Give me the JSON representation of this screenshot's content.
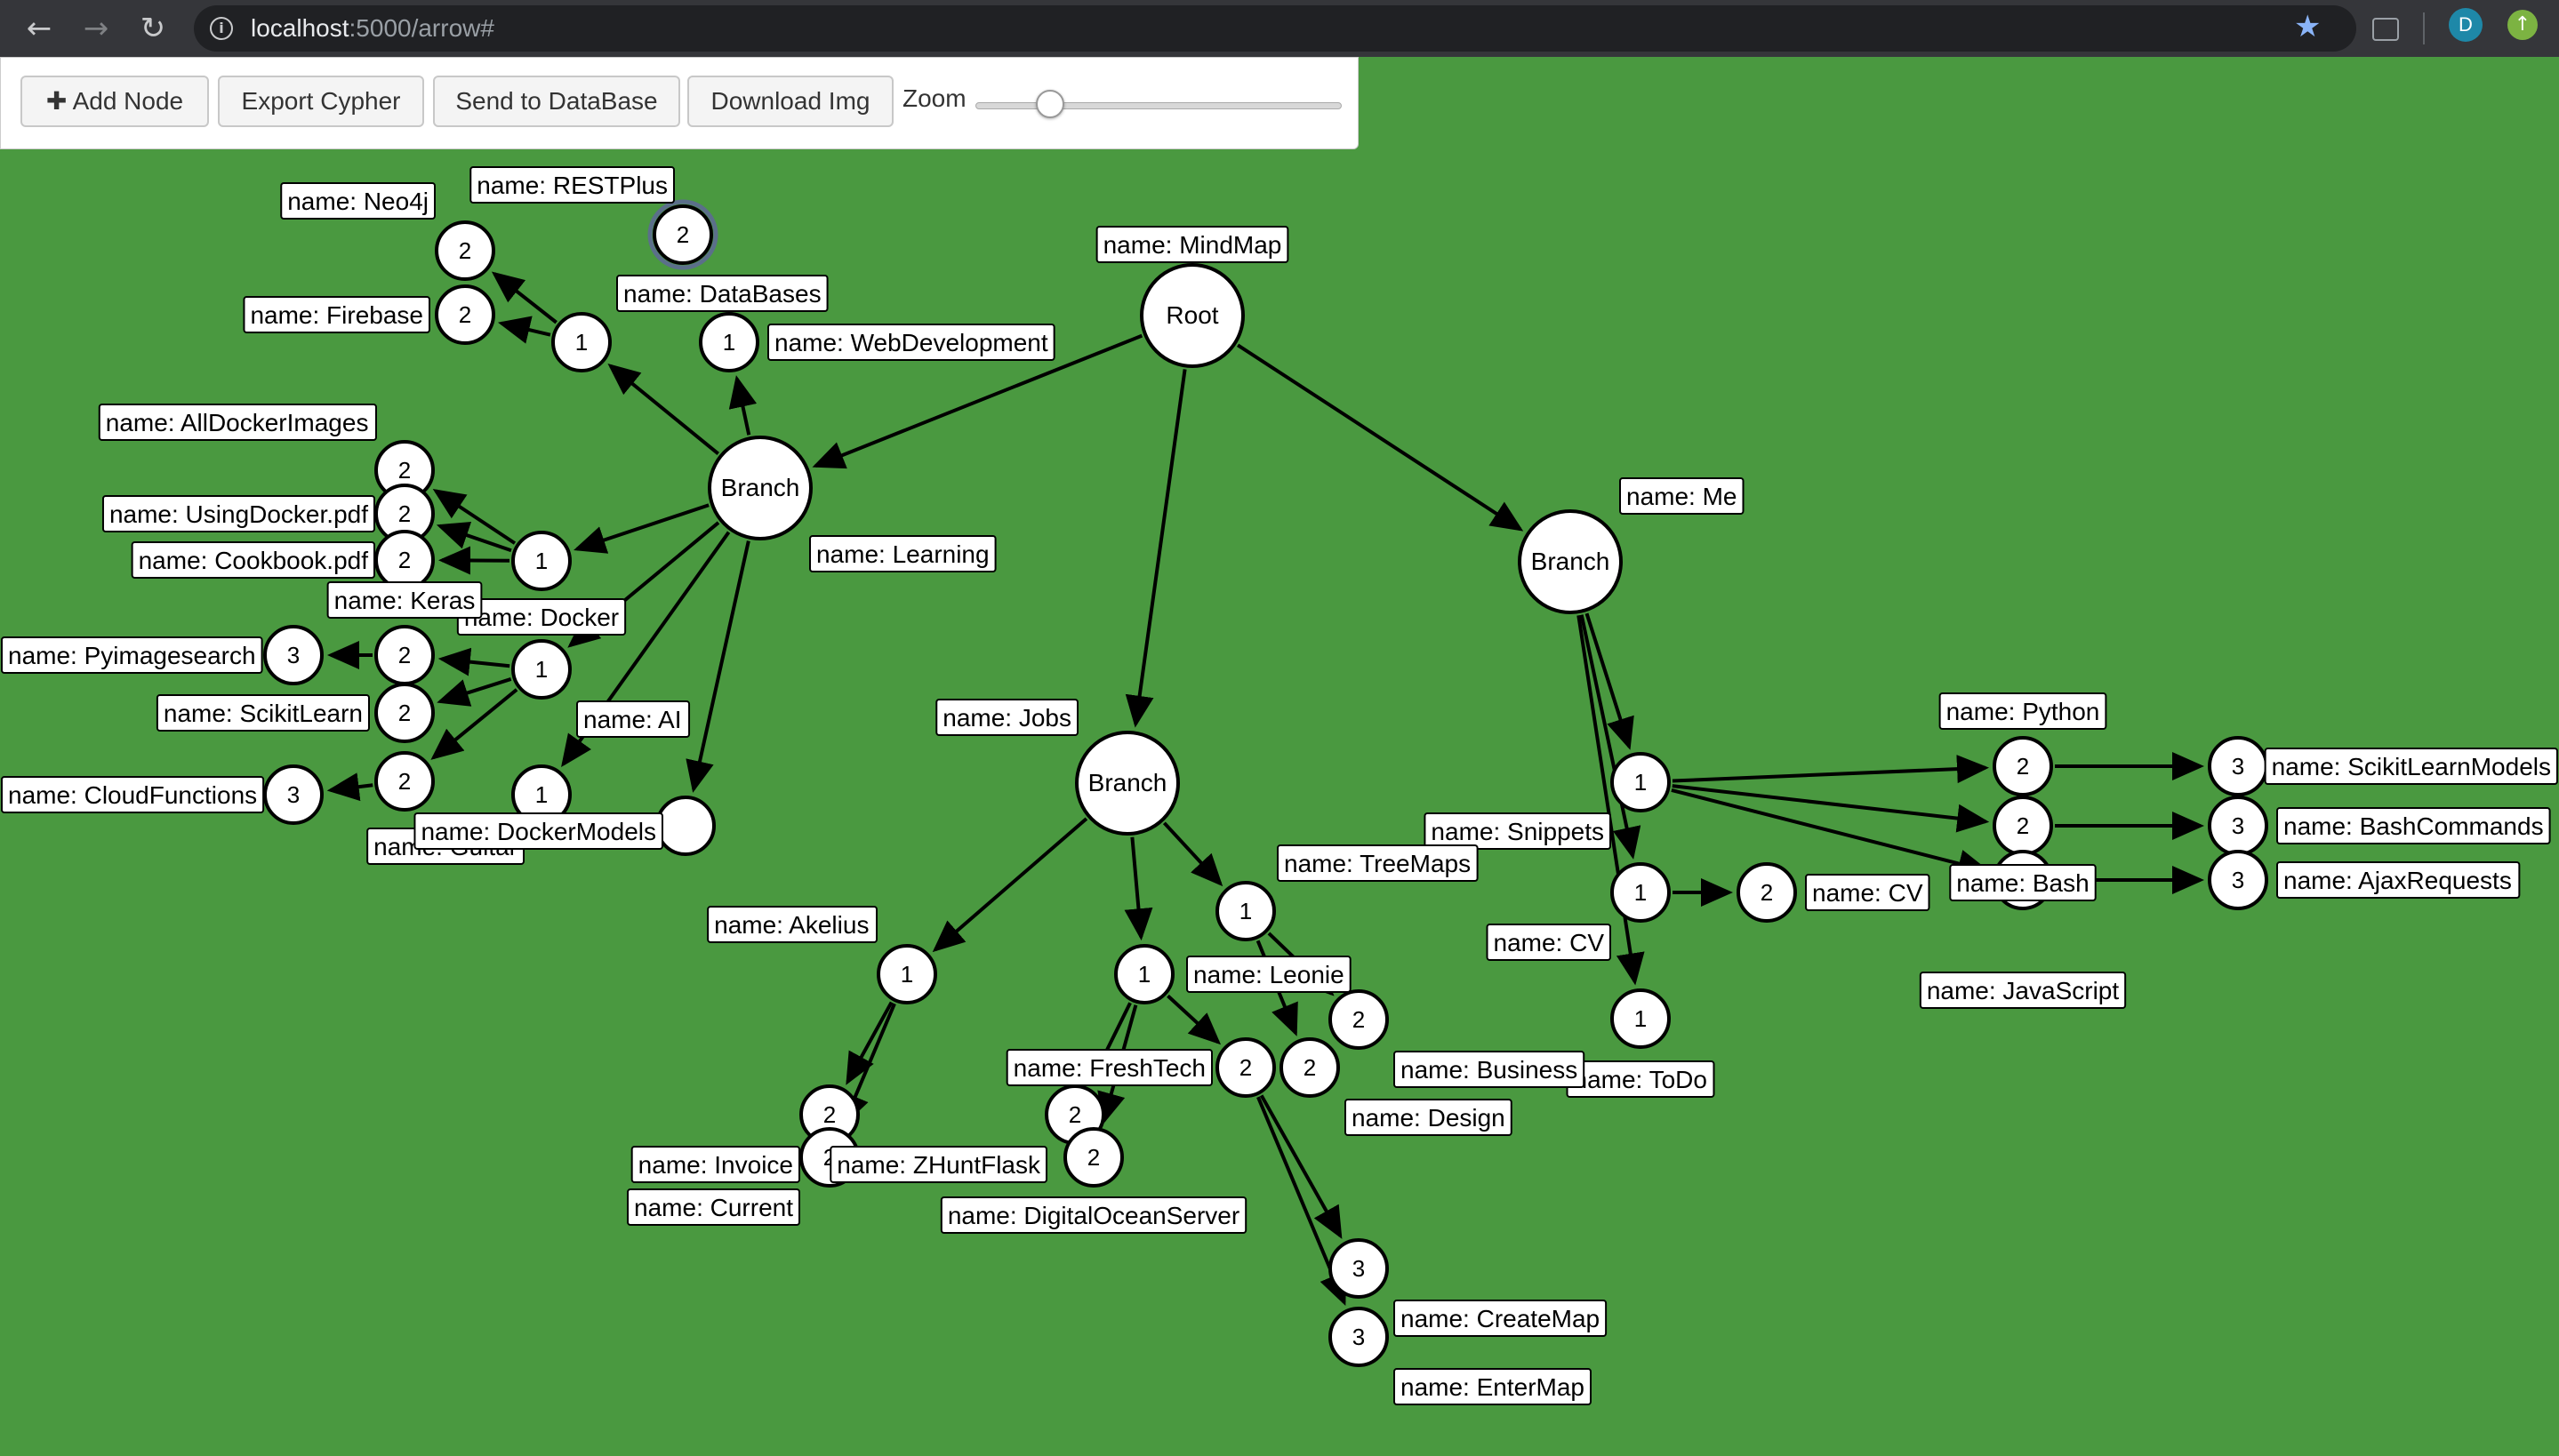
{
  "browser": {
    "url_host": "localhost",
    "url_rest": ":5000/arrow#",
    "avatar_letter": "D",
    "back_icon": "back-arrow-icon",
    "forward_icon": "forward-arrow-icon",
    "reload_icon": "reload-icon",
    "info_icon": "info-icon",
    "star_icon": "bookmark-star-icon",
    "bookmark_star_color": "#8ab4f8"
  },
  "toolbar": {
    "add_node": "Add Node",
    "export_cypher": "Export Cypher",
    "send_db": "Send to DataBase",
    "download_img": "Download Img",
    "zoom_label": "Zoom",
    "zoom_value": 0.2
  },
  "colors": {
    "background": "#4a9940",
    "node_fill": "#ffffff",
    "node_stroke": "#000000",
    "edge": "#000000",
    "selected_ring": "#5b6f8a"
  },
  "graph": {
    "nodes": [
      {
        "id": "root",
        "caption": "Root",
        "label": "name: MindMap",
        "size": "large"
      },
      {
        "id": "learning",
        "caption": "Branch",
        "label": "name: Learning",
        "size": "large"
      },
      {
        "id": "me",
        "caption": "Branch",
        "label": "name: Me",
        "size": "large"
      },
      {
        "id": "jobs",
        "caption": "Branch",
        "label": "name: Jobs",
        "size": "large"
      },
      {
        "id": "databases",
        "caption": "1",
        "label": "name: DataBases"
      },
      {
        "id": "webdev",
        "caption": "1",
        "label": "name: WebDevelopment"
      },
      {
        "id": "restplus",
        "caption": "2",
        "label": "name: RESTPlus",
        "selected": true
      },
      {
        "id": "neo4j",
        "caption": "2",
        "label": "name: Neo4j"
      },
      {
        "id": "firebase",
        "caption": "2",
        "label": "name: Firebase"
      },
      {
        "id": "docker",
        "caption": "1",
        "label": "name: Docker"
      },
      {
        "id": "alldocker",
        "caption": "2",
        "label": "name: AllDockerImages"
      },
      {
        "id": "usingdocker",
        "caption": "2",
        "label": "name: UsingDocker.pdf"
      },
      {
        "id": "cookbook",
        "caption": "2",
        "label": "name: Cookbook.pdf"
      },
      {
        "id": "ai",
        "caption": "1",
        "label": "name: AI"
      },
      {
        "id": "keras",
        "caption": "2",
        "label": "name: Keras"
      },
      {
        "id": "pyimage",
        "caption": "3",
        "label": "name: Pyimagesearch"
      },
      {
        "id": "scikitlearn",
        "caption": "2",
        "label": "name: ScikitLearn"
      },
      {
        "id": "cloud2",
        "caption": "2",
        "label": ""
      },
      {
        "id": "cloudfn",
        "caption": "3",
        "label": "name: CloudFunctions"
      },
      {
        "id": "hidden1",
        "caption": "1",
        "label": "name: Guitar"
      },
      {
        "id": "dockermodels",
        "caption": "",
        "label": "name: DockerModels"
      },
      {
        "id": "snippets",
        "caption": "1",
        "label": "name: Snippets"
      },
      {
        "id": "python",
        "caption": "2",
        "label": "name: Python"
      },
      {
        "id": "bash",
        "caption": "2",
        "label": "name: Bash"
      },
      {
        "id": "javascript",
        "caption": "2",
        "label": "name: JavaScript"
      },
      {
        "id": "scikitmodels",
        "caption": "3",
        "label": "name: ScikitLearnModels"
      },
      {
        "id": "bashcmds",
        "caption": "3",
        "label": "name: BashCommands"
      },
      {
        "id": "ajax",
        "caption": "3",
        "label": "name: AjaxRequests"
      },
      {
        "id": "cv1",
        "caption": "1",
        "label": "name: CV"
      },
      {
        "id": "cv2",
        "caption": "2",
        "label": "name: CV"
      },
      {
        "id": "todo",
        "caption": "1",
        "label": "name: ToDo"
      },
      {
        "id": "akelius",
        "caption": "1",
        "label": "name: Akelius"
      },
      {
        "id": "invoice",
        "caption": "2",
        "label": "name: Invoice"
      },
      {
        "id": "current",
        "caption": "2",
        "label": "name: Current"
      },
      {
        "id": "leonie",
        "caption": "1",
        "label": "name: Leonie"
      },
      {
        "id": "freshtech",
        "caption": "2",
        "label": "name: FreshTech"
      },
      {
        "id": "zhunt",
        "caption": "2",
        "label": "name: ZHuntFlask"
      },
      {
        "id": "digitalocean",
        "caption": "2",
        "label": "name: DigitalOceanServer"
      },
      {
        "id": "treemaps",
        "caption": "1",
        "label": "name: TreeMaps"
      },
      {
        "id": "business",
        "caption": "2",
        "label": "name: Business"
      },
      {
        "id": "design",
        "caption": "2",
        "label": "name: Design"
      },
      {
        "id": "createmap",
        "caption": "3",
        "label": "name: CreateMap"
      },
      {
        "id": "entermap",
        "caption": "3",
        "label": "name: EnterMap"
      }
    ],
    "edges": [
      [
        "root",
        "learning"
      ],
      [
        "root",
        "me"
      ],
      [
        "root",
        "jobs"
      ],
      [
        "learning",
        "databases"
      ],
      [
        "learning",
        "webdev"
      ],
      [
        "learning",
        "docker"
      ],
      [
        "learning",
        "ai"
      ],
      [
        "learning",
        "hidden1"
      ],
      [
        "learning",
        "dockermodels"
      ],
      [
        "databases",
        "neo4j"
      ],
      [
        "databases",
        "firebase"
      ],
      [
        "docker",
        "alldocker"
      ],
      [
        "docker",
        "usingdocker"
      ],
      [
        "docker",
        "cookbook"
      ],
      [
        "ai",
        "keras"
      ],
      [
        "ai",
        "scikitlearn"
      ],
      [
        "ai",
        "cloud2"
      ],
      [
        "keras",
        "pyimage"
      ],
      [
        "cloud2",
        "cloudfn"
      ],
      [
        "me",
        "snippets"
      ],
      [
        "me",
        "cv1"
      ],
      [
        "me",
        "todo"
      ],
      [
        "snippets",
        "python"
      ],
      [
        "snippets",
        "bash"
      ],
      [
        "snippets",
        "javascript"
      ],
      [
        "python",
        "scikitmodels"
      ],
      [
        "bash",
        "bashcmds"
      ],
      [
        "javascript",
        "ajax"
      ],
      [
        "cv1",
        "cv2"
      ],
      [
        "jobs",
        "akelius"
      ],
      [
        "jobs",
        "leonie"
      ],
      [
        "jobs",
        "treemaps"
      ],
      [
        "akelius",
        "invoice"
      ],
      [
        "akelius",
        "current"
      ],
      [
        "leonie",
        "freshtech"
      ],
      [
        "leonie",
        "zhunt"
      ],
      [
        "leonie",
        "digitalocean"
      ],
      [
        "treemaps",
        "business"
      ],
      [
        "treemaps",
        "design"
      ],
      [
        "freshtech",
        "createmap"
      ],
      [
        "freshtech",
        "entermap"
      ]
    ]
  }
}
